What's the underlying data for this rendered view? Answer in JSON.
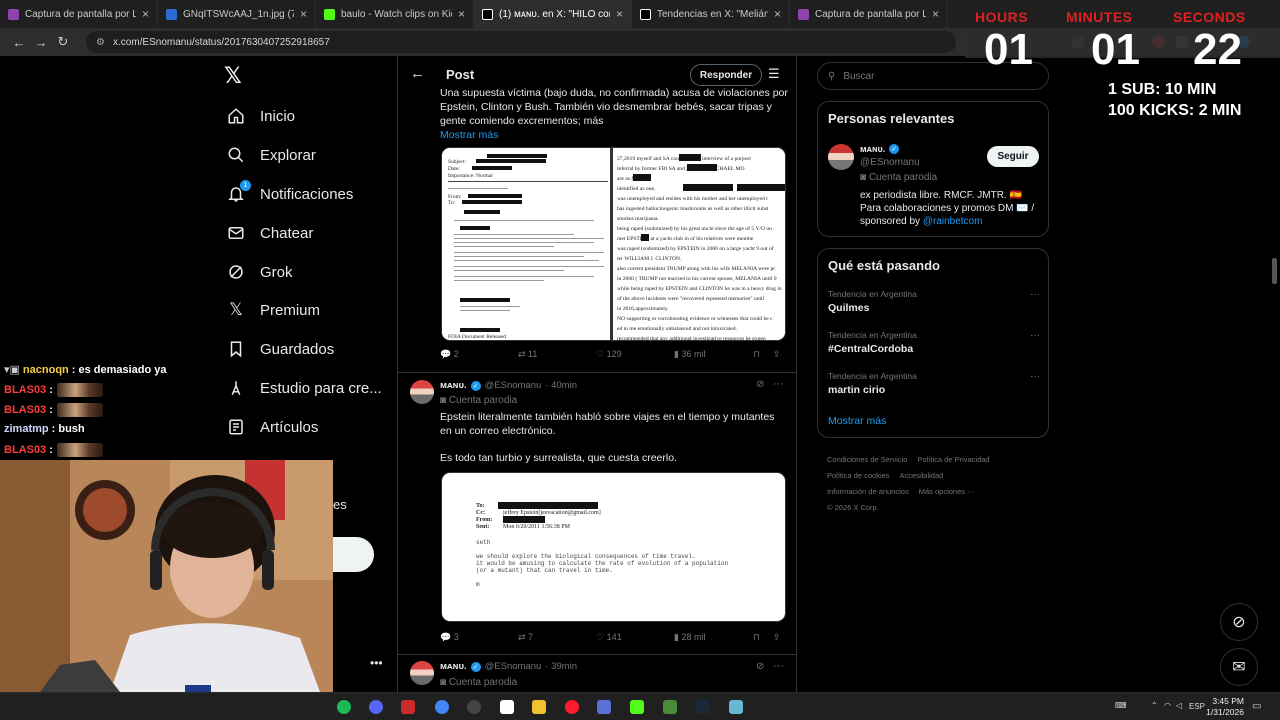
{
  "browser": {
    "tabs": [
      {
        "title": "Captura de pantalla por Lightsh",
        "color": "#8e44ad",
        "active": false
      },
      {
        "title": "GNqITSWcAAJ_1n.jpg (720×96",
        "color": "#2b6cd4",
        "active": false
      },
      {
        "title": "baulo - Watch clips on Kick",
        "color": "#53fc18",
        "active": false
      },
      {
        "title": "(1) ᴍᴀɴᴜ. en X: \"HILO con todas",
        "color": "#ffffff",
        "active": true
      },
      {
        "title": "Tendencias en X: \"Melián\": Por",
        "color": "#ffffff",
        "active": false
      },
      {
        "title": "Captura de pantalla por Lightsh",
        "color": "#8e44ad",
        "active": false
      }
    ],
    "close_glyph": "×",
    "url": "x.com/ESnomanu/status/2017630407252918657"
  },
  "timer": {
    "hours_label": "HOURS",
    "minutes_label": "MINUTES",
    "seconds_label": "SECONDS",
    "hours": "01",
    "minutes": "01",
    "seconds": "22",
    "rule1": "1 SUB: 10 MIN",
    "rule2": "100 KICKS: 2 MIN"
  },
  "nav": {
    "items": [
      {
        "label": "Inicio",
        "icon": "home-icon"
      },
      {
        "label": "Explorar",
        "icon": "search-icon"
      },
      {
        "label": "Notificaciones",
        "icon": "bell-icon",
        "badge": "1"
      },
      {
        "label": "Chatear",
        "icon": "mail-icon"
      },
      {
        "label": "Grok",
        "icon": "grok-icon"
      },
      {
        "label": "Premium",
        "icon": "x-icon"
      },
      {
        "label": "Guardados",
        "icon": "bookmark-icon"
      },
      {
        "label": "Estudio para cre...",
        "icon": "studio-icon"
      },
      {
        "label": "Artículos",
        "icon": "article-icon"
      }
    ],
    "partial_text": "es"
  },
  "post_header": {
    "title": "Post",
    "reply_label": "Responder"
  },
  "tweets": [
    {
      "text": "Una supuesta víctima (bajo duda, no confirmada) acusa de violaciones por Epstein, Clinton y Bush. También vio desmembrar bebés, sacar tripas y gente comiendo excrementos; más",
      "show_more": "Mostrar más",
      "doc_left": {
        "text_lines": [
          "Subject:",
          "Date:",
          "Importance: Normal",
          "From:",
          "To:"
        ],
        "footer": "FOIA Document Released"
      },
      "doc_right": {
        "lines": [
          "27,2019 myself and SA        conducted an interview of a purport",
          "referral by former FBI SA          and journalist MICHAEL MO",
          "are as follows:",
          "identified as one,",
          "was unemployed and resides with his mother and her unemployed r",
          "has ingested hallucinogenic mushrooms as well as other illicit subst",
          "smokes marijuana.",
          "being raped (sodomized) by his great uncle since the age of 5 Y/O un",
          "met EPSTEIN at a yacht club in    of his relatives were membe",
          "was raped (sodomized) by EPSTEIN in 2000 on a large yacht 9 out of",
          "ter WILLIAM J. CLINTON.",
          "also current president TRUMP along with his wife MELANIA were pr",
          "in 2000 ( TRUMP not married to his current spouse, MELANIA until 0",
          "while being raped by EPSTEIN and CLINTON he was in a heavy drug in",
          "of the above incidents were \"recovered repressed memories\" until",
          "in 2016,approximately.",
          "NO supporting or corroborating evidence or witnesses that could be c",
          "ed to me emotionally unbalanced and not intoxicated.",
          "recommended that any additional investigative resources be expen"
        ]
      },
      "stats": {
        "replies": "2",
        "reposts": "11",
        "likes": "129",
        "views": "36 mil"
      }
    },
    {
      "author": "ᴍᴀɴᴜ.",
      "handle": "@ESnomanu",
      "time": "· 40min",
      "parody": "Cuenta parodia",
      "text1": "Epstein literalmente también habló sobre viajes en el tiempo y mutantes en un correo electrónico.",
      "text2": "Es todo tan turbio y surrealista, que cuesta creerlo.",
      "email": {
        "to_label": "To:",
        "cc_label": "Cc:",
        "from_label": "From:",
        "sent_label": "Sent:",
        "cc_value": "jeffrey Epstein[jeevacation@gmail.com]",
        "sent_value": "Mon 6/20/2011 1:56:38 PM",
        "body": "seth\n\nwe should explore the biological consequences of time travel.\nit would be amusing to calculate the rate of evolution of a population\n(or a mutant) that can travel in time.\n\nm"
      },
      "stats": {
        "replies": "3",
        "reposts": "7",
        "likes": "141",
        "views": "28 mil"
      }
    },
    {
      "author": "ᴍᴀɴᴜ.",
      "handle": "@ESnomanu",
      "time": "· 39min",
      "parody": "Cuenta parodia"
    }
  ],
  "right": {
    "search_placeholder": "Buscar",
    "relevant": {
      "title": "Personas relevantes",
      "name": "ᴍᴀɴᴜ.",
      "handle": "@ESnomanu",
      "parody": "Cuenta parodia",
      "bio": "ex periodista libre. RMCF. JMTR. 🇪🇸 Para colaboraciones y promos DM ✉️ / sponsored by",
      "bio_link": "@rainbetcom",
      "follow_label": "Seguir"
    },
    "trends": {
      "title": "Qué está pasando",
      "items": [
        {
          "context": "Tendencia en Argentina",
          "name": "Quilmes"
        },
        {
          "context": "Tendencia en Argentina",
          "name": "#CentralCordoba"
        },
        {
          "context": "Tendencia en Argentina",
          "name": "martin cirio"
        }
      ],
      "show_more": "Mostrar más"
    },
    "footer": {
      "links": [
        "Condiciones de Servicio",
        "Política de Privacidad",
        "Política de cookies",
        "Accesibilidad",
        "Información de anuncios",
        "Más opciones ···"
      ],
      "copyright": "© 2026 X Corp."
    }
  },
  "chat": [
    {
      "user": "nacnoqn",
      "msg": ": es demasiado ya",
      "color": "#f5d142",
      "emote": false
    },
    {
      "user": "BLAS03",
      "msg": ":",
      "color": "#ff3b3b",
      "emote": true
    },
    {
      "user": "BLAS03",
      "msg": ":",
      "color": "#ff3b3b",
      "emote": true
    },
    {
      "user": "zimatmp",
      "msg": ": bush",
      "color": "#cfd8ff",
      "emote": false
    },
    {
      "user": "BLAS03",
      "msg": ":",
      "color": "#ff3b3b",
      "emote": true
    }
  ],
  "taskbar": {
    "lang": "ESP",
    "time": "3:45 PM",
    "date": "1/31/2026"
  }
}
